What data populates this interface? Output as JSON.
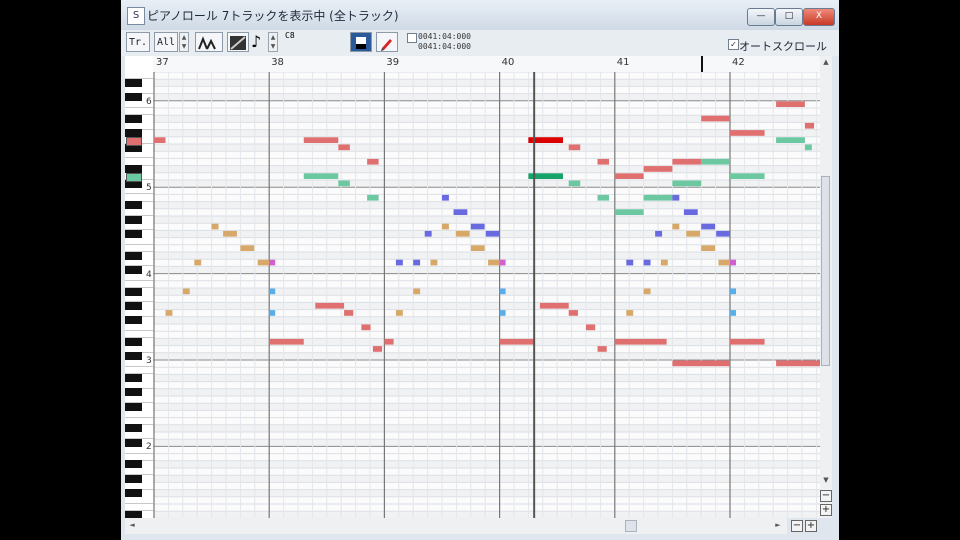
{
  "window": {
    "icon_label": "S",
    "title": "ピアノロール 7トラックを表示中 (全トラック)",
    "buttons": {
      "minimize": "—",
      "maximize": "□",
      "close": "X"
    }
  },
  "toolbar": {
    "track_label": "Tr.",
    "track_value": "All",
    "note_value": "C8",
    "time_line1": "0041:04:000",
    "time_line2": "0041:04:000",
    "autoscroll_label": "オートスクロール",
    "autoscroll_checked": "✓"
  },
  "ruler": {
    "bars": [
      "37",
      "38",
      "39",
      "40",
      "41",
      "42"
    ]
  },
  "keyboard": {
    "octave_labels": [
      "6",
      "5",
      "4",
      "3",
      "2"
    ]
  },
  "scroll": {
    "up": "▲",
    "down": "▼",
    "left": "◄",
    "right": "►",
    "zoom_in": "+",
    "zoom_out": "−"
  },
  "colors": {
    "track_red": "#e07070",
    "track_red_selected": "#dd0000",
    "track_green": "#6cc8a0",
    "track_green_selected": "#15a36a",
    "track_blue": "#6a6ae0",
    "track_tan": "#d7a868",
    "track_magenta": "#d060d0",
    "track_cyan": "#5aaee8"
  },
  "notes": [
    {
      "track": "red",
      "bar": 37.0,
      "len": 0.1,
      "pitch": 79
    },
    {
      "track": "red",
      "bar": 38.3,
      "len": 0.3,
      "pitch": 79
    },
    {
      "track": "red",
      "bar": 38.6,
      "len": 0.1,
      "pitch": 78
    },
    {
      "track": "red",
      "bar": 38.85,
      "len": 0.1,
      "pitch": 76
    },
    {
      "track": "red",
      "bar": 40.25,
      "len": 0.3,
      "pitch": 79
    },
    {
      "track": "red",
      "bar": 40.6,
      "len": 0.1,
      "pitch": 78
    },
    {
      "track": "red",
      "bar": 40.85,
      "len": 0.1,
      "pitch": 76
    },
    {
      "track": "red",
      "bar": 41.0,
      "len": 0.25,
      "pitch": 74
    },
    {
      "track": "red",
      "bar": 41.25,
      "len": 0.25,
      "pitch": 75
    },
    {
      "track": "red",
      "bar": 41.5,
      "len": 0.25,
      "pitch": 76
    },
    {
      "track": "red",
      "bar": 41.75,
      "len": 0.25,
      "pitch": 82
    },
    {
      "track": "red",
      "bar": 42.0,
      "len": 0.3,
      "pitch": 80
    },
    {
      "track": "red",
      "bar": 42.4,
      "len": 0.25,
      "pitch": 84
    },
    {
      "track": "red",
      "bar": 42.65,
      "len": 0.08,
      "pitch": 81
    },
    {
      "track": "red",
      "bar": 38.4,
      "len": 0.25,
      "pitch": 56
    },
    {
      "track": "red",
      "bar": 38.65,
      "len": 0.08,
      "pitch": 55
    },
    {
      "track": "red",
      "bar": 38.8,
      "len": 0.08,
      "pitch": 53
    },
    {
      "track": "red",
      "bar": 38.9,
      "len": 0.08,
      "pitch": 50
    },
    {
      "track": "red",
      "bar": 39.0,
      "len": 0.08,
      "pitch": 51
    },
    {
      "track": "red",
      "bar": 38.0,
      "len": 0.3,
      "pitch": 51
    },
    {
      "track": "red",
      "bar": 40.0,
      "len": 0.3,
      "pitch": 51
    },
    {
      "track": "red",
      "bar": 40.35,
      "len": 0.25,
      "pitch": 56
    },
    {
      "track": "red",
      "bar": 40.6,
      "len": 0.08,
      "pitch": 55
    },
    {
      "track": "red",
      "bar": 40.75,
      "len": 0.08,
      "pitch": 53
    },
    {
      "track": "red",
      "bar": 40.85,
      "len": 0.08,
      "pitch": 50
    },
    {
      "track": "red",
      "bar": 41.0,
      "len": 0.45,
      "pitch": 51
    },
    {
      "track": "red",
      "bar": 41.5,
      "len": 0.5,
      "pitch": 48
    },
    {
      "track": "red",
      "bar": 42.0,
      "len": 0.3,
      "pitch": 51
    },
    {
      "track": "red",
      "bar": 42.4,
      "len": 0.4,
      "pitch": 48
    },
    {
      "track": "green",
      "bar": 38.3,
      "len": 0.3,
      "pitch": 74
    },
    {
      "track": "green",
      "bar": 38.6,
      "len": 0.1,
      "pitch": 73
    },
    {
      "track": "green",
      "bar": 38.85,
      "len": 0.1,
      "pitch": 71
    },
    {
      "track": "green",
      "bar": 40.6,
      "len": 0.1,
      "pitch": 73
    },
    {
      "track": "green",
      "bar": 40.85,
      "len": 0.1,
      "pitch": 71
    },
    {
      "track": "green",
      "bar": 41.0,
      "len": 0.25,
      "pitch": 69
    },
    {
      "track": "green",
      "bar": 41.25,
      "len": 0.25,
      "pitch": 71
    },
    {
      "track": "green",
      "bar": 41.5,
      "len": 0.25,
      "pitch": 73
    },
    {
      "track": "green",
      "bar": 41.75,
      "len": 0.25,
      "pitch": 76
    },
    {
      "track": "green",
      "bar": 42.0,
      "len": 0.3,
      "pitch": 74
    },
    {
      "track": "green",
      "bar": 42.4,
      "len": 0.25,
      "pitch": 79
    },
    {
      "track": "green",
      "bar": 42.65,
      "len": 0.06,
      "pitch": 78
    },
    {
      "track": "blue",
      "bar": 39.5,
      "len": 0.06,
      "pitch": 71
    },
    {
      "track": "blue",
      "bar": 39.6,
      "len": 0.12,
      "pitch": 69
    },
    {
      "track": "blue",
      "bar": 39.75,
      "len": 0.12,
      "pitch": 67
    },
    {
      "track": "blue",
      "bar": 39.88,
      "len": 0.12,
      "pitch": 66
    },
    {
      "track": "blue",
      "bar": 39.35,
      "len": 0.06,
      "pitch": 66
    },
    {
      "track": "blue",
      "bar": 39.1,
      "len": 0.06,
      "pitch": 62
    },
    {
      "track": "blue",
      "bar": 39.25,
      "len": 0.06,
      "pitch": 62
    },
    {
      "track": "blue",
      "bar": 41.5,
      "len": 0.06,
      "pitch": 71
    },
    {
      "track": "blue",
      "bar": 41.6,
      "len": 0.12,
      "pitch": 69
    },
    {
      "track": "blue",
      "bar": 41.75,
      "len": 0.12,
      "pitch": 67
    },
    {
      "track": "blue",
      "bar": 41.88,
      "len": 0.12,
      "pitch": 66
    },
    {
      "track": "blue",
      "bar": 41.35,
      "len": 0.06,
      "pitch": 66
    },
    {
      "track": "blue",
      "bar": 41.1,
      "len": 0.06,
      "pitch": 62
    },
    {
      "track": "blue",
      "bar": 41.25,
      "len": 0.06,
      "pitch": 62
    },
    {
      "track": "tan",
      "bar": 37.1,
      "len": 0.06,
      "pitch": 55
    },
    {
      "track": "tan",
      "bar": 37.25,
      "len": 0.06,
      "pitch": 58
    },
    {
      "track": "tan",
      "bar": 37.35,
      "len": 0.06,
      "pitch": 62
    },
    {
      "track": "tan",
      "bar": 37.5,
      "len": 0.06,
      "pitch": 67
    },
    {
      "track": "tan",
      "bar": 37.6,
      "len": 0.12,
      "pitch": 66
    },
    {
      "track": "tan",
      "bar": 37.75,
      "len": 0.12,
      "pitch": 64
    },
    {
      "track": "tan",
      "bar": 37.9,
      "len": 0.1,
      "pitch": 62
    },
    {
      "track": "tan",
      "bar": 39.1,
      "len": 0.06,
      "pitch": 55
    },
    {
      "track": "tan",
      "bar": 39.25,
      "len": 0.06,
      "pitch": 58
    },
    {
      "track": "tan",
      "bar": 39.4,
      "len": 0.06,
      "pitch": 62
    },
    {
      "track": "tan",
      "bar": 39.5,
      "len": 0.06,
      "pitch": 67
    },
    {
      "track": "tan",
      "bar": 39.62,
      "len": 0.12,
      "pitch": 66
    },
    {
      "track": "tan",
      "bar": 39.75,
      "len": 0.12,
      "pitch": 64
    },
    {
      "track": "tan",
      "bar": 39.9,
      "len": 0.1,
      "pitch": 62
    },
    {
      "track": "tan",
      "bar": 41.1,
      "len": 0.06,
      "pitch": 55
    },
    {
      "track": "tan",
      "bar": 41.25,
      "len": 0.06,
      "pitch": 58
    },
    {
      "track": "tan",
      "bar": 41.4,
      "len": 0.06,
      "pitch": 62
    },
    {
      "track": "tan",
      "bar": 41.5,
      "len": 0.06,
      "pitch": 67
    },
    {
      "track": "tan",
      "bar": 41.62,
      "len": 0.12,
      "pitch": 66
    },
    {
      "track": "tan",
      "bar": 41.75,
      "len": 0.12,
      "pitch": 64
    },
    {
      "track": "tan",
      "bar": 41.9,
      "len": 0.1,
      "pitch": 62
    },
    {
      "track": "magenta",
      "bar": 38.0,
      "len": 0.05,
      "pitch": 62
    },
    {
      "track": "magenta",
      "bar": 40.0,
      "len": 0.05,
      "pitch": 62
    },
    {
      "track": "magenta",
      "bar": 42.0,
      "len": 0.05,
      "pitch": 62
    },
    {
      "track": "cyan",
      "bar": 38.0,
      "len": 0.05,
      "pitch": 58
    },
    {
      "track": "cyan",
      "bar": 38.0,
      "len": 0.05,
      "pitch": 55
    },
    {
      "track": "cyan",
      "bar": 40.0,
      "len": 0.05,
      "pitch": 58
    },
    {
      "track": "cyan",
      "bar": 40.0,
      "len": 0.05,
      "pitch": 55
    },
    {
      "track": "cyan",
      "bar": 42.0,
      "len": 0.05,
      "pitch": 58
    },
    {
      "track": "cyan",
      "bar": 42.0,
      "len": 0.05,
      "pitch": 55
    }
  ],
  "selected_notes": [
    {
      "track": "red",
      "bar": 40.25,
      "pitch": 79
    },
    {
      "track": "green",
      "bar": 40.25,
      "pitch": 74
    }
  ],
  "playhead_bar": 40.3,
  "cursor_bar": 41.75
}
